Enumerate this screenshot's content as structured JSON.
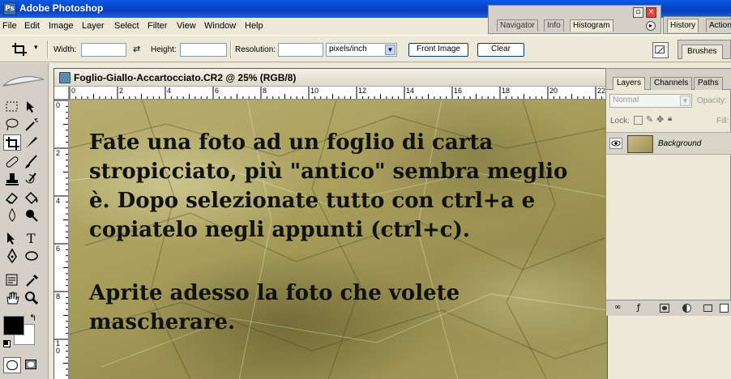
{
  "app": {
    "title": "Adobe Photoshop",
    "logo_text": "Ps"
  },
  "menu": [
    "File",
    "Edit",
    "Image",
    "Layer",
    "Select",
    "Filter",
    "View",
    "Window",
    "Help"
  ],
  "options": {
    "width_label": "Width:",
    "width_value": "",
    "height_label": "Height:",
    "height_value": "",
    "resolution_label": "Resolution:",
    "resolution_value": "",
    "units_value": "pixels/inch",
    "front_image_label": "Front Image",
    "clear_label": "Clear"
  },
  "navigator_palette": {
    "tabs": [
      "Navigator",
      "Info",
      "Histogram"
    ],
    "active_tab": "Histogram",
    "minimize_glyph": "▫",
    "close_glyph": "×"
  },
  "history_palette": {
    "tabs": [
      "History",
      "Actions"
    ]
  },
  "brushes_palette": {
    "tab": "Brushes"
  },
  "document": {
    "title": "Foglio-Giallo-Accartocciato.CR2 @ 25% (RGB/8)",
    "h_ruler_labels": [
      "0",
      "2",
      "4",
      "6",
      "8",
      "10",
      "12",
      "14",
      "16",
      "18",
      "20",
      "22"
    ],
    "v_ruler_labels": [
      "0",
      "2",
      "4",
      "6",
      "8",
      "10"
    ],
    "canvas_text": [
      "Fate una foto ad un foglio di carta",
      "stropicciato, più \"antico\" sembra meglio",
      "è. Dopo selezionate tutto con ctrl+a e",
      "copiatelo negli appunti (ctrl+c).",
      "",
      "Aprite adesso la foto che volete",
      "mascherare."
    ]
  },
  "layers_palette": {
    "tabs": [
      "Layers",
      "Channels",
      "Paths"
    ],
    "active_tab": "Layers",
    "blend_mode": "Normal",
    "opacity_label": "Opacity:",
    "lock_label": "Lock:",
    "fill_label": "Fill:",
    "layers": [
      {
        "name": "Background",
        "visible": true
      }
    ]
  },
  "colors": {
    "foreground": "#000000",
    "background": "#ffffff",
    "titlebar": "#0a5ae8",
    "paper": "#a89f5c"
  }
}
